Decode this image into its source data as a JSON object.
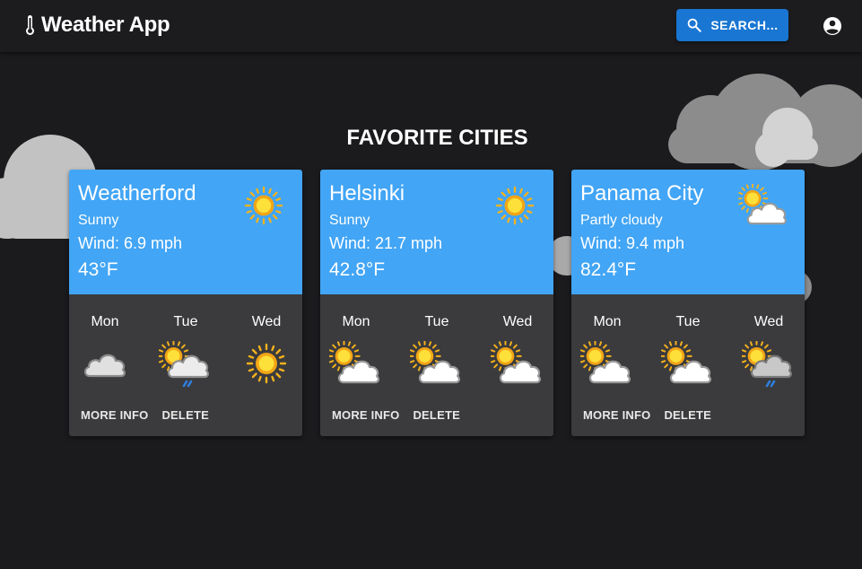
{
  "header": {
    "title": "Weather App",
    "search_label": "SEARCH..."
  },
  "section_title": "FAVORITE CITIES",
  "cities": [
    {
      "name": "Weatherford",
      "condition": "Sunny",
      "wind": "Wind: 6.9 mph",
      "temp": "43°F",
      "icon": "sun-icon",
      "forecast": [
        {
          "day": "Mon",
          "icon": "cloud-icon"
        },
        {
          "day": "Tue",
          "icon": "partly-cloudy-rain-icon"
        },
        {
          "day": "Wed",
          "icon": "sun-icon"
        }
      ],
      "more_info_label": "MORE INFO",
      "delete_label": "DELETE"
    },
    {
      "name": "Helsinki",
      "condition": "Sunny",
      "wind": "Wind: 21.7 mph",
      "temp": "42.8°F",
      "icon": "sun-icon",
      "forecast": [
        {
          "day": "Mon",
          "icon": "partly-cloudy-icon"
        },
        {
          "day": "Tue",
          "icon": "partly-cloudy-icon"
        },
        {
          "day": "Wed",
          "icon": "partly-cloudy-icon"
        }
      ],
      "more_info_label": "MORE INFO",
      "delete_label": "DELETE"
    },
    {
      "name": "Panama City",
      "condition": "Partly cloudy",
      "wind": "Wind: 9.4 mph",
      "temp": "82.4°F",
      "icon": "partly-cloudy-icon",
      "forecast": [
        {
          "day": "Mon",
          "icon": "partly-cloudy-icon"
        },
        {
          "day": "Tue",
          "icon": "partly-cloudy-icon"
        },
        {
          "day": "Wed",
          "icon": "partly-cloudy-rain-icon"
        }
      ],
      "more_info_label": "MORE INFO",
      "delete_label": "DELETE"
    }
  ],
  "colors": {
    "background": "#1b1b1e",
    "app_bar": "#1c1c1f",
    "accent": "#1976d2",
    "card_top": "#42a5f5",
    "card_bottom": "#3b3b3d"
  }
}
